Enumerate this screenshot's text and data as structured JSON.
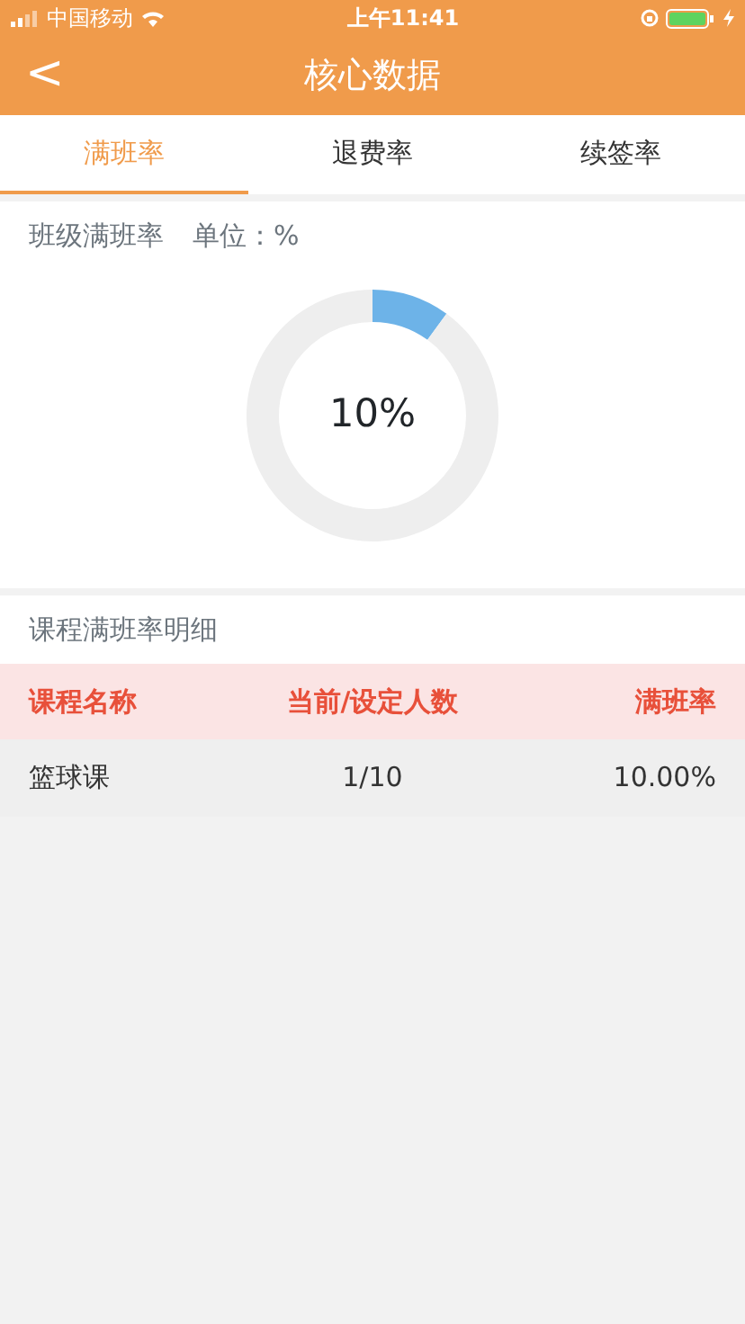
{
  "status_bar": {
    "carrier": "中国移动",
    "time": "上午11:41"
  },
  "nav_bar": {
    "back": "<",
    "title": "核心数据"
  },
  "tabs": [
    {
      "label": "满班率",
      "selected": true
    },
    {
      "label": "退费率",
      "selected": false
    },
    {
      "label": "续签率",
      "selected": false
    }
  ],
  "summary": {
    "title": "班级满班率",
    "unit": "单位：%",
    "center_label": "10%",
    "chart_data": {
      "type": "donut",
      "values": [
        10,
        90
      ]
    }
  },
  "detail": {
    "title": "课程满班率明细",
    "columns": [
      "课程名称",
      "当前/设定人数",
      "满班率"
    ],
    "rows": [
      [
        "篮球课",
        "1/10",
        "10.00%"
      ]
    ]
  }
}
